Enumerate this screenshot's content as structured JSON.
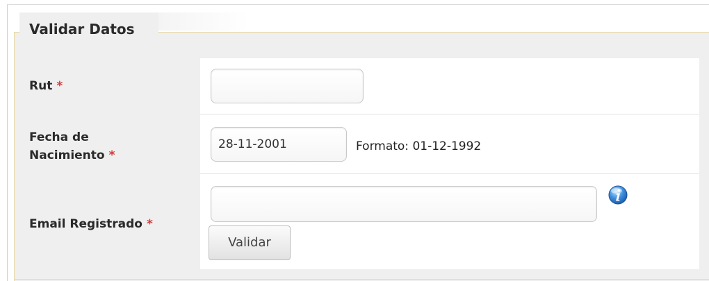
{
  "form": {
    "legend": "Validar Datos",
    "required_mark": "*",
    "rut": {
      "label": "Rut",
      "value": ""
    },
    "birth": {
      "label_line1": "Fecha de",
      "label_line2": "Nacimiento",
      "value": "28-11-2001",
      "hint": "Formato: 01-12-1992"
    },
    "email": {
      "label": "Email Registrado",
      "value": ""
    },
    "submit_label": "Validar"
  },
  "colors": {
    "required": "#d43a3a",
    "fieldset_border": "#e8d9a6",
    "fieldset_bg": "#efefef"
  },
  "icons": {
    "info": "info-icon"
  }
}
